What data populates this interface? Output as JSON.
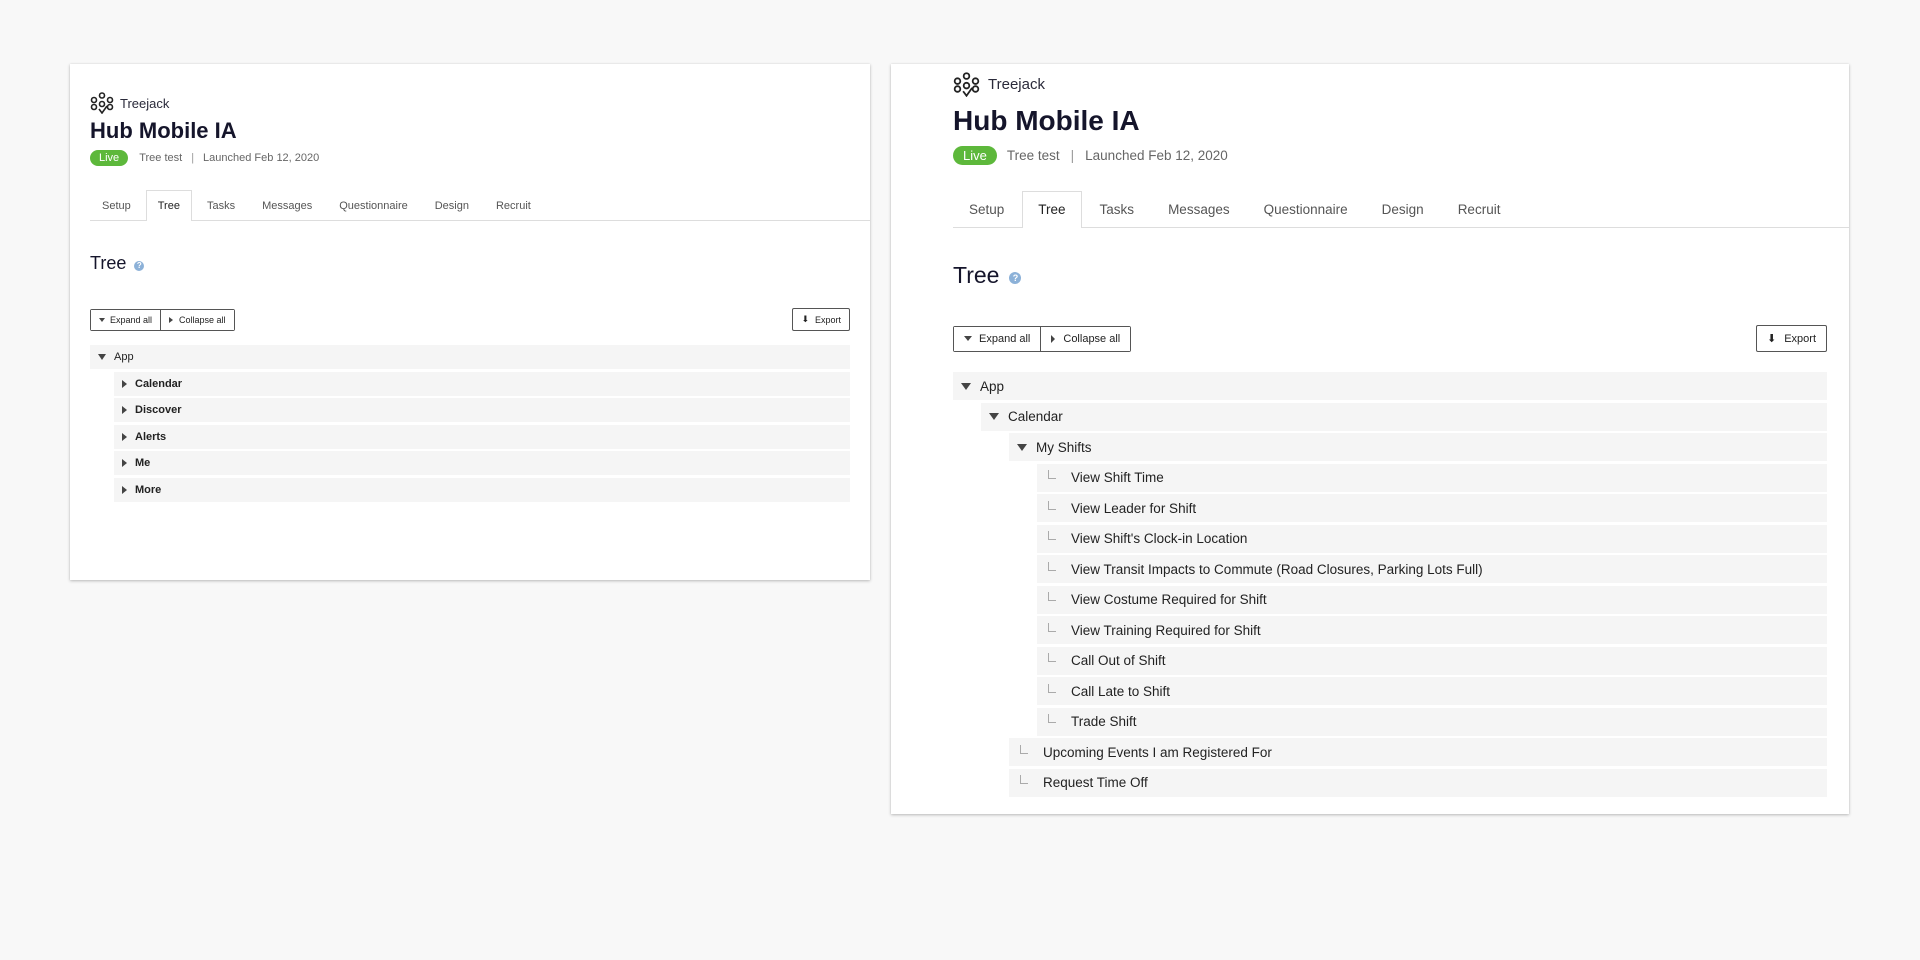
{
  "left_panel": {
    "brand": "Treejack",
    "title": "Hub Mobile IA",
    "status_badge": "Live",
    "test_type": "Tree test",
    "separator": "|",
    "launched": "Launched Feb 12, 2020",
    "tabs": [
      "Setup",
      "Tree",
      "Tasks",
      "Messages",
      "Questionnaire",
      "Design",
      "Recruit"
    ],
    "active_tab": "Tree",
    "section_title": "Tree",
    "expand_all": "Expand all",
    "collapse_all": "Collapse all",
    "export": "Export",
    "tree": {
      "root": "App",
      "children": [
        "Calendar",
        "Discover",
        "Alerts",
        "Me",
        "More"
      ]
    }
  },
  "right_panel": {
    "brand": "Treejack",
    "title": "Hub Mobile IA",
    "status_badge": "Live",
    "test_type": "Tree test",
    "separator": "|",
    "launched": "Launched Feb 12, 2020",
    "tabs": [
      "Setup",
      "Tree",
      "Tasks",
      "Messages",
      "Questionnaire",
      "Design",
      "Recruit"
    ],
    "active_tab": "Tree",
    "section_title": "Tree",
    "expand_all": "Expand all",
    "collapse_all": "Collapse all",
    "export": "Export",
    "tree": {
      "root": "App",
      "calendar": "Calendar",
      "my_shifts": "My Shifts",
      "my_shifts_children": [
        "View Shift Time",
        "View Leader for Shift",
        "View Shift's Clock-in Location",
        "View Transit Impacts to Commute (Road Closures, Parking Lots Full)",
        "View Costume Required for Shift",
        "View Training Required for Shift",
        "Call Out of Shift",
        "Call Late to Shift",
        "Trade Shift"
      ],
      "calendar_children": [
        "Upcoming Events I am Registered For",
        "Request Time Off"
      ]
    }
  },
  "colors": {
    "page_background": "#f8f8f8",
    "live_badge": "#5db83b",
    "title_text": "#15152b",
    "help_icon": "#8cb1d8",
    "tree_row_bg": "#f5f5f5"
  }
}
